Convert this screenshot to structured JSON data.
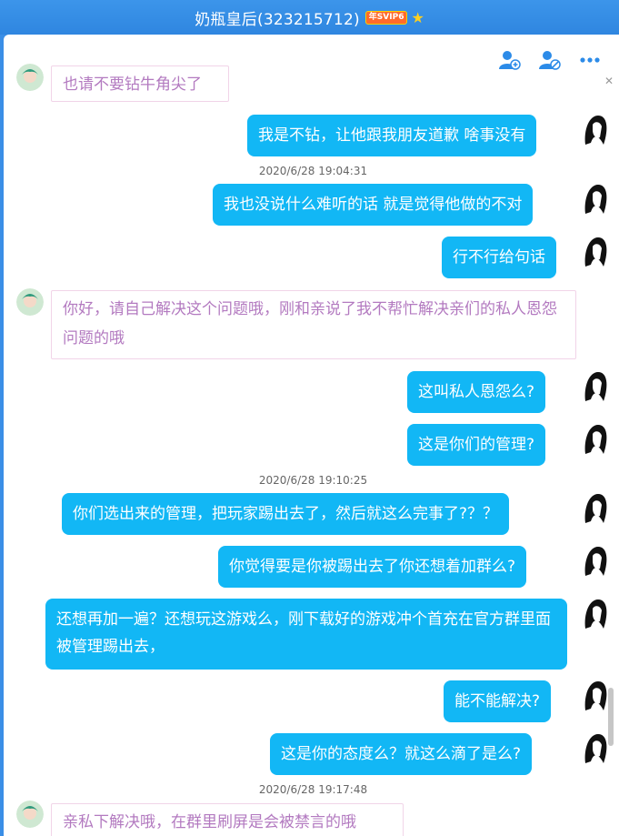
{
  "window": {
    "title": "奶瓶皇后(323215712)",
    "badge": "年SVIP6",
    "star_icon": "star-icon",
    "accent": "#2f86e0"
  },
  "toolbar": {
    "icons": [
      "add-member-icon",
      "remove-member-icon",
      "more-icon"
    ]
  },
  "colors": {
    "outgoing_bubble": "#12b7f5",
    "incoming_text": "#b37ac0"
  },
  "messages": [
    {
      "dir": "in",
      "text": "也请不要钻牛角尖了"
    },
    {
      "dir": "out",
      "text": "我是不钻，让他跟我朋友道歉 啥事没有"
    },
    {
      "timestamp": "2020/6/28 19:04:31"
    },
    {
      "dir": "out",
      "text": "我也没说什么难听的话 就是觉得他做的不对"
    },
    {
      "dir": "out",
      "text": "行不行给句话"
    },
    {
      "dir": "in",
      "text": "你好，请自己解决这个问题哦，刚和亲说了我不帮忙解决亲们的私人恩怨问题的哦"
    },
    {
      "dir": "out",
      "text": "这叫私人恩怨么?"
    },
    {
      "dir": "out",
      "text": "这是你们的管理?"
    },
    {
      "timestamp": "2020/6/28 19:10:25"
    },
    {
      "dir": "out",
      "text": "你们选出来的管理，把玩家踢出去了，然后就这么完事了?？？"
    },
    {
      "dir": "out",
      "text": "你觉得要是你被踢出去了你还想着加群么?"
    },
    {
      "dir": "out",
      "text": "还想再加一遍？还想玩这游戏么，刚下载好的游戏冲个首充在官方群里面被管理踢出去，"
    },
    {
      "dir": "out",
      "text": "能不能解决?"
    },
    {
      "dir": "out",
      "text": "这是你的态度么？就这么滴了是么?"
    },
    {
      "timestamp": "2020/6/28 19:17:48"
    },
    {
      "dir": "in",
      "text": "亲私下解决哦，在群里刷屏是会被禁言的哦"
    }
  ]
}
